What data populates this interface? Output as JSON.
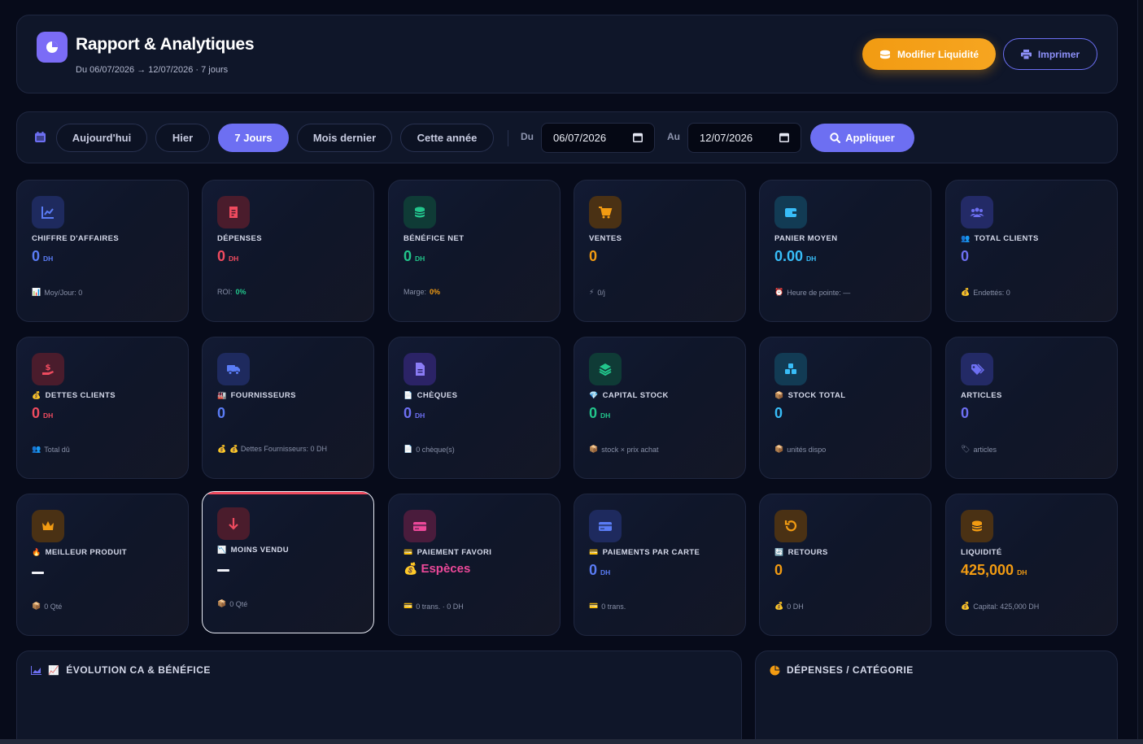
{
  "header": {
    "title": "Rapport & Analytiques",
    "subtitle": "Du 06/07/2026 → 12/07/2026 · 7 jours",
    "btn_liquidite": "Modifier Liquidité",
    "btn_imprimer": "Imprimer",
    "logo_icon": "chart-pie-icon"
  },
  "filters": {
    "presets": [
      "Aujourd'hui",
      "Hier",
      "7 Jours",
      "Mois dernier",
      "Cette année"
    ],
    "active_preset": "7 Jours",
    "from_label": "Du",
    "from_value": "06/07/2026",
    "to_label": "Au",
    "to_value": "12/07/2026",
    "apply_label": "Appliquer"
  },
  "colors": {
    "accent": "#6d6ff2",
    "orange": "#f29b12",
    "blue": "#5a7cf5",
    "red": "#ef4b5f",
    "green": "#22c58b",
    "pink": "#ec4899"
  },
  "cards": [
    {
      "icon": "line-chart-icon",
      "label": "CHIFFRE D'AFFAIRES",
      "label_prefix": "",
      "value": "0",
      "unit": "DH",
      "foot_icon": "📊",
      "foot": "Moy/Jour: 0",
      "foot_accent": ""
    },
    {
      "icon": "receipt-icon",
      "label": "DÉPENSES",
      "label_prefix": "",
      "value": "0",
      "unit": "DH",
      "foot_icon": "",
      "foot": "ROI: ",
      "foot_accent": "0%"
    },
    {
      "icon": "coins-icon",
      "label": "BÉNÉFICE NET",
      "label_prefix": "",
      "value": "0",
      "unit": "DH",
      "foot_icon": "",
      "foot": "Marge: ",
      "foot_accent": "0%"
    },
    {
      "icon": "cart-icon",
      "label": "VENTES",
      "label_prefix": "",
      "value": "0",
      "unit": "",
      "foot_icon": "⚡",
      "foot": "0/j",
      "foot_accent": ""
    },
    {
      "icon": "wallet-icon",
      "label": "PANIER MOYEN",
      "label_prefix": "",
      "value": "0.00",
      "unit": "DH",
      "foot_icon": "⏰",
      "foot": "Heure de pointe: —",
      "foot_accent": ""
    },
    {
      "icon": "users-icon",
      "label": "TOTAL CLIENTS",
      "label_prefix": "👥",
      "value": "0",
      "unit": "",
      "foot_icon": "💰",
      "foot": "Endettés: 0",
      "foot_accent": ""
    },
    {
      "icon": "hand-dollar-icon",
      "label": "DETTES CLIENTS",
      "label_prefix": "💰",
      "value": "0",
      "unit": "DH",
      "foot_icon": "👥",
      "foot": "Total dû",
      "foot_accent": ""
    },
    {
      "icon": "truck-icon",
      "label": "FOURNISSEURS",
      "label_prefix": "🏭",
      "value": "0",
      "unit": "",
      "foot_icon": "💰",
      "foot": "💰 Dettes Fournisseurs: 0 DH",
      "foot_accent": ""
    },
    {
      "icon": "document-icon",
      "label": "CHÈQUES",
      "label_prefix": "📄",
      "value": "0",
      "unit": "DH",
      "foot_icon": "📄",
      "foot": "0 chèque(s)",
      "foot_accent": ""
    },
    {
      "icon": "layers-icon",
      "label": "CAPITAL STOCK",
      "label_prefix": "💎",
      "value": "0",
      "unit": "DH",
      "foot_icon": "📦",
      "foot": "stock × prix achat",
      "foot_accent": ""
    },
    {
      "icon": "boxes-icon",
      "label": "STOCK TOTAL",
      "label_prefix": "📦",
      "value": "0",
      "unit": "",
      "foot_icon": "📦",
      "foot": "unités dispo",
      "foot_accent": ""
    },
    {
      "icon": "tags-icon",
      "label": "ARTICLES",
      "label_prefix": "",
      "value": "0",
      "unit": "",
      "foot_icon": "🏷",
      "foot": "articles",
      "foot_accent": ""
    },
    {
      "icon": "crown-icon",
      "label": "MEILLEUR PRODUIT",
      "label_prefix": "🔥",
      "value": "—",
      "unit": "",
      "foot_icon": "📦",
      "foot": "0 Qté",
      "foot_accent": ""
    },
    {
      "icon": "arrow-down-icon",
      "label": "MOINS VENDU",
      "label_prefix": "📉",
      "value": "—",
      "unit": "",
      "foot_icon": "📦",
      "foot": "0 Qté",
      "foot_accent": ""
    },
    {
      "icon": "credit-card-icon",
      "label": "PAIEMENT FAVORI",
      "label_prefix": "💳",
      "value": "Espèces",
      "unit": "",
      "value_prefix": "💰",
      "foot_icon": "💳",
      "foot": "0 trans. · 0 DH",
      "foot_accent": ""
    },
    {
      "icon": "credit-card-icon",
      "label": "PAIEMENTS PAR CARTE",
      "label_prefix": "💳",
      "value": "0",
      "unit": "DH",
      "foot_icon": "💳",
      "foot": "0 trans.",
      "foot_accent": ""
    },
    {
      "icon": "undo-icon",
      "label": "RETOURS",
      "label_prefix": "🔄",
      "value": "0",
      "unit": "",
      "foot_icon": "💰",
      "foot": "0 DH",
      "foot_accent": ""
    },
    {
      "icon": "coins-stack-icon",
      "label": "LIQUIDITÉ",
      "label_prefix": "",
      "value": "425,000",
      "unit": "DH",
      "foot_icon": "💰",
      "foot": "Capital: 425,000 DH",
      "foot_accent": ""
    }
  ],
  "panels": {
    "evolution_title": "ÉVOLUTION CA & BÉNÉFICE",
    "evolution_emoji": "📈",
    "depenses_title": "DÉPENSES / CATÉGORIE"
  }
}
